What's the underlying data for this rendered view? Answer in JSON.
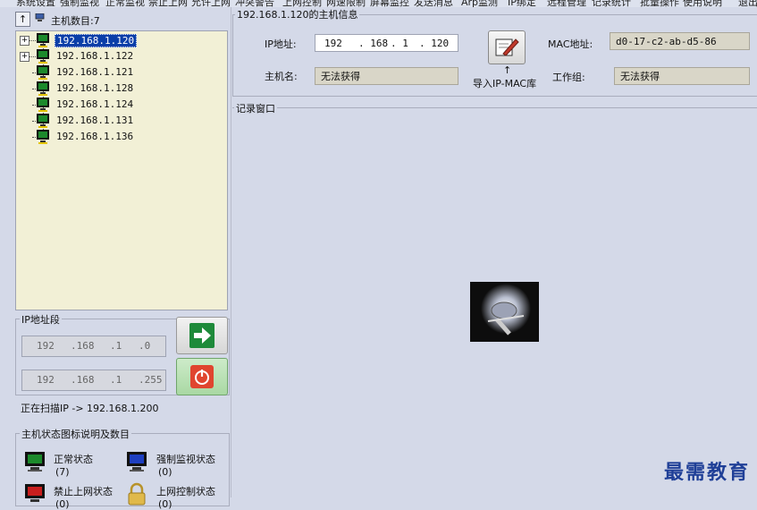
{
  "menu": [
    "系统设置",
    "强制监视",
    "正常监视",
    "禁止上网",
    "允许上网",
    "冲突警告",
    "上网控制",
    "网速限制",
    "屏幕监控",
    "发送消息",
    "Arp监测",
    "IP绑定",
    "远程管理",
    "记录统计",
    "批量操作",
    "使用说明",
    "退出"
  ],
  "host_list": {
    "up_label": "↑",
    "count_label": "主机数目:7",
    "hosts": [
      {
        "ip": "192.168.1.120",
        "expander": "+",
        "selected": true
      },
      {
        "ip": "192.168.1.122",
        "expander": "+",
        "selected": false
      },
      {
        "ip": "192.168.1.121",
        "expander": "",
        "selected": false
      },
      {
        "ip": "192.168.1.128",
        "expander": "",
        "selected": false
      },
      {
        "ip": "192.168.1.124",
        "expander": "",
        "selected": false
      },
      {
        "ip": "192.168.1.131",
        "expander": "",
        "selected": false
      },
      {
        "ip": "192.168.1.136",
        "expander": "",
        "selected": false
      }
    ]
  },
  "ip_range": {
    "title": "IP地址段",
    "start": [
      "192",
      ".168",
      ".1",
      ".0"
    ],
    "end": [
      "192",
      ".168",
      ".1",
      ".255"
    ]
  },
  "scan_status": "正在扫描IP -> 192.168.1.200",
  "legend": {
    "title": "主机状态图标说明及数目",
    "items": [
      {
        "label": "正常状态",
        "count": "(7)",
        "icon": "monitor-green-icon"
      },
      {
        "label": "强制监视状态",
        "count": "(0)",
        "icon": "monitor-blue-icon"
      },
      {
        "label": "禁止上网状态",
        "count": "(0)",
        "icon": "monitor-red-icon"
      },
      {
        "label": "上网控制状态",
        "count": "(0)",
        "icon": "lock-icon"
      }
    ]
  },
  "host_info": {
    "title": "192.168.1.120的主机信息",
    "ip_label": "IP地址:",
    "ip_parts": [
      "192",
      ". 168",
      ". 1",
      ". 120"
    ],
    "mac_label": "MAC地址:",
    "mac_value": "d0-17-c2-ab-d5-86",
    "hostname_label": "主机名:",
    "hostname_value": "无法获得",
    "workgroup_label": "工作组:",
    "workgroup_value": "无法获得",
    "import_label": "导入IP-MAC库",
    "import_arrow": "↑"
  },
  "log": {
    "title": "记录窗口"
  },
  "watermark": "最需教育",
  "colors": {
    "selection": "#0a3ea8",
    "tree_bg": "#f2f0d6",
    "panel_bg": "#d4d9e8"
  }
}
